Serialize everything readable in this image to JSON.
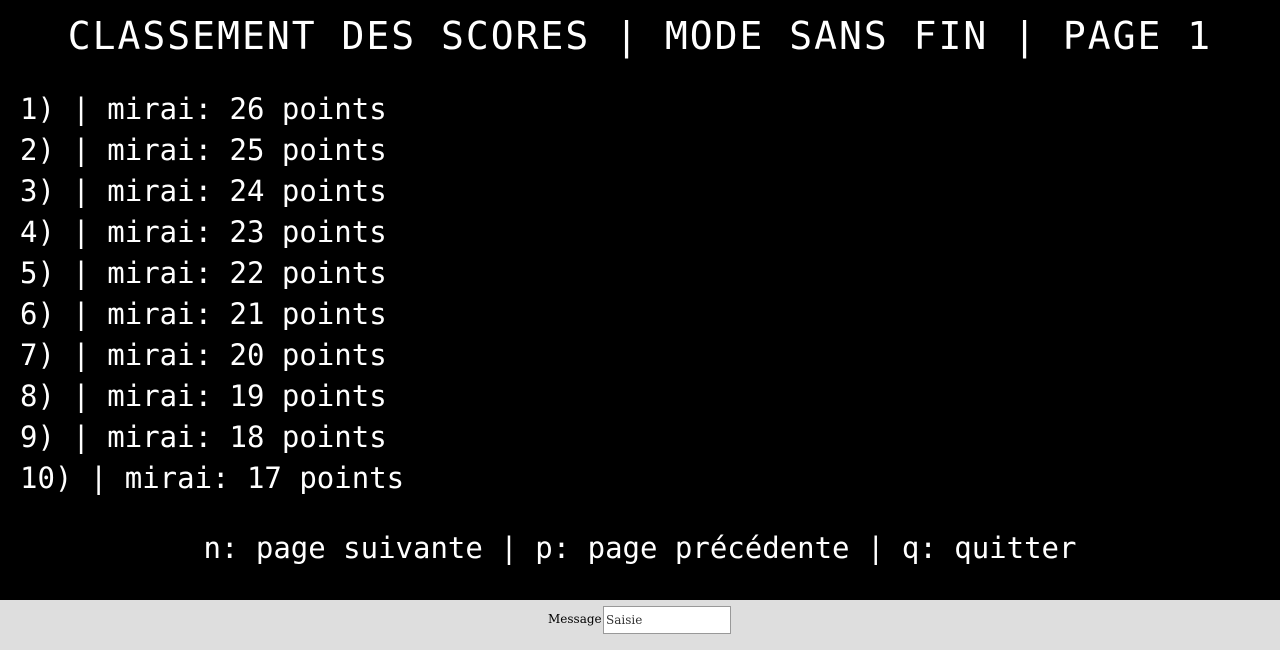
{
  "screen": {
    "title": "CLASSEMENT DES SCORES | MODE SANS FIN | PAGE 1",
    "scores": [
      "1) | mirai: 26 points",
      "2) | mirai: 25 points",
      "3) | mirai: 24 points",
      "4) | mirai: 23 points",
      "5) | mirai: 22 points",
      "6) | mirai: 21 points",
      "7) | mirai: 20 points",
      "8) | mirai: 19 points",
      "9) | mirai: 18 points",
      "10) | mirai: 17 points"
    ],
    "help": "n: page suivante | p: page précédente | q: quitter"
  },
  "input_bar": {
    "label": "Message",
    "placeholder": "Saisie",
    "value": ""
  },
  "colors": {
    "background": "#000000",
    "text": "#ffffff",
    "input_bar": "#dedede"
  }
}
